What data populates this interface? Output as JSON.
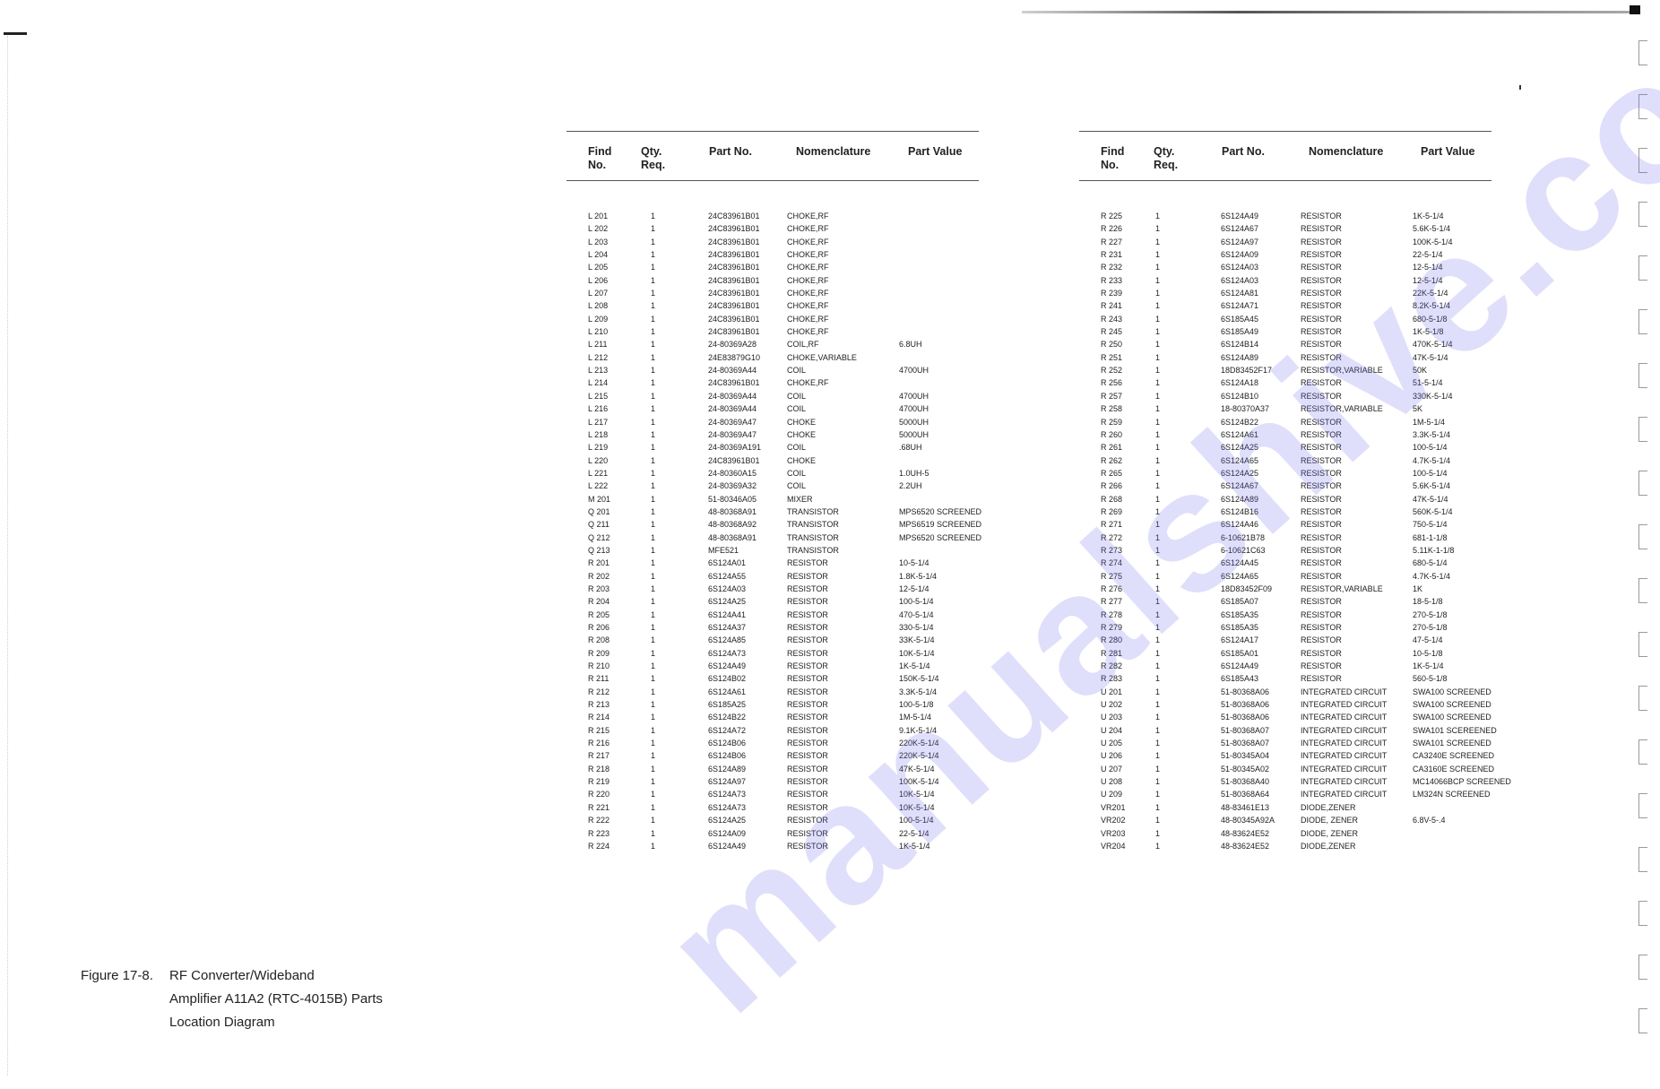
{
  "figure_caption": {
    "label": "Figure 17-8.",
    "lines": [
      "RF Converter/Wideband",
      "Amplifier A11A2 (RTC-4015B) Parts",
      "Location Diagram"
    ]
  },
  "watermark": "manualshive.com",
  "columns": {
    "find": "Find",
    "find2": "No.",
    "qty": "Qty.",
    "qty2": "Req.",
    "part_no": "Part No.",
    "nomenclature": "Nomenclature",
    "part_value": "Part Value"
  },
  "left_table": [
    {
      "find": "L 201",
      "qty": "1",
      "part_no": "24C83961B01",
      "nom": "CHOKE,RF",
      "value": ""
    },
    {
      "find": "L 202",
      "qty": "1",
      "part_no": "24C83961B01",
      "nom": "CHOKE,RF",
      "value": ""
    },
    {
      "find": "L 203",
      "qty": "1",
      "part_no": "24C83961B01",
      "nom": "CHOKE,RF",
      "value": ""
    },
    {
      "find": "L 204",
      "qty": "1",
      "part_no": "24C83961B01",
      "nom": "CHOKE,RF",
      "value": ""
    },
    {
      "find": "L 205",
      "qty": "1",
      "part_no": "24C83961B01",
      "nom": "CHOKE,RF",
      "value": ""
    },
    {
      "find": "L 206",
      "qty": "1",
      "part_no": "24C83961B01",
      "nom": "CHOKE,RF",
      "value": ""
    },
    {
      "find": "L 207",
      "qty": "1",
      "part_no": "24C83961B01",
      "nom": "CHOKE,RF",
      "value": ""
    },
    {
      "find": "L 208",
      "qty": "1",
      "part_no": "24C83961B01",
      "nom": "CHOKE,RF",
      "value": ""
    },
    {
      "find": "L 209",
      "qty": "1",
      "part_no": "24C83961B01",
      "nom": "CHOKE,RF",
      "value": ""
    },
    {
      "find": "L 210",
      "qty": "1",
      "part_no": "24C83961B01",
      "nom": "CHOKE,RF",
      "value": ""
    },
    {
      "find": "L 211",
      "qty": "1",
      "part_no": "24-80369A28",
      "nom": "COIL,RF",
      "value": "6.8UH"
    },
    {
      "find": "L 212",
      "qty": "1",
      "part_no": "24E83879G10",
      "nom": "CHOKE,VARIABLE",
      "value": ""
    },
    {
      "find": "L 213",
      "qty": "1",
      "part_no": "24-80369A44",
      "nom": "COIL",
      "value": "4700UH"
    },
    {
      "find": "L 214",
      "qty": "1",
      "part_no": "24C83961B01",
      "nom": "CHOKE,RF",
      "value": ""
    },
    {
      "find": "L 215",
      "qty": "1",
      "part_no": "24-80369A44",
      "nom": "COIL",
      "value": "4700UH"
    },
    {
      "find": "L 216",
      "qty": "1",
      "part_no": "24-80369A44",
      "nom": "COIL",
      "value": "4700UH"
    },
    {
      "find": "L 217",
      "qty": "1",
      "part_no": "24-80369A47",
      "nom": "CHOKE",
      "value": "5000UH"
    },
    {
      "find": "L 218",
      "qty": "1",
      "part_no": "24-80369A47",
      "nom": "CHOKE",
      "value": "5000UH"
    },
    {
      "find": "L 219",
      "qty": "1",
      "part_no": "24-80369A191",
      "nom": "COIL",
      "value": ".68UH"
    },
    {
      "find": "L 220",
      "qty": "1",
      "part_no": "24C83961B01",
      "nom": "CHOKE",
      "value": ""
    },
    {
      "find": "L 221",
      "qty": "1",
      "part_no": "24-80360A15",
      "nom": "COIL",
      "value": "1.0UH-5"
    },
    {
      "find": "L 222",
      "qty": "1",
      "part_no": "24-80369A32",
      "nom": "COIL",
      "value": "2.2UH"
    },
    {
      "find": "M 201",
      "qty": "1",
      "part_no": "51-80346A05",
      "nom": "MIXER",
      "value": ""
    },
    {
      "find": "Q 201",
      "qty": "1",
      "part_no": "48-80368A91",
      "nom": "TRANSISTOR",
      "value": "MPS6520 SCREENED"
    },
    {
      "find": "Q 211",
      "qty": "1",
      "part_no": "48-80368A92",
      "nom": "TRANSISTOR",
      "value": "MPS6519 SCREENED"
    },
    {
      "find": "Q 212",
      "qty": "1",
      "part_no": "48-80368A91",
      "nom": "TRANSISTOR",
      "value": "MPS6520 SCREENED"
    },
    {
      "find": "Q 213",
      "qty": "1",
      "part_no": "MFE521",
      "nom": "TRANSISTOR",
      "value": ""
    },
    {
      "find": "R 201",
      "qty": "1",
      "part_no": "6S124A01",
      "nom": "RESISTOR",
      "value": "10-5-1/4"
    },
    {
      "find": "R 202",
      "qty": "1",
      "part_no": "6S124A55",
      "nom": "RESISTOR",
      "value": "1.8K-5-1/4"
    },
    {
      "find": "R 203",
      "qty": "1",
      "part_no": "6S124A03",
      "nom": "RESISTOR",
      "value": "12-5-1/4"
    },
    {
      "find": "R 204",
      "qty": "1",
      "part_no": "6S124A25",
      "nom": "RESISTOR",
      "value": "100-5-1/4"
    },
    {
      "find": "R 205",
      "qty": "1",
      "part_no": "6S124A41",
      "nom": "RESISTOR",
      "value": "470-5-1/4"
    },
    {
      "find": "R 206",
      "qty": "1",
      "part_no": "6S124A37",
      "nom": "RESISTOR",
      "value": "330-5-1/4"
    },
    {
      "find": "R 208",
      "qty": "1",
      "part_no": "6S124A85",
      "nom": "RESISTOR",
      "value": "33K-5-1/4"
    },
    {
      "find": "R 209",
      "qty": "1",
      "part_no": "6S124A73",
      "nom": "RESISTOR",
      "value": "10K-5-1/4"
    },
    {
      "find": "R 210",
      "qty": "1",
      "part_no": "6S124A49",
      "nom": "RESISTOR",
      "value": "1K-5-1/4"
    },
    {
      "find": "R 211",
      "qty": "1",
      "part_no": "6S124B02",
      "nom": "RESISTOR",
      "value": "150K-5-1/4"
    },
    {
      "find": "R 212",
      "qty": "1",
      "part_no": "6S124A61",
      "nom": "RESISTOR",
      "value": "3.3K-5-1/4"
    },
    {
      "find": "R 213",
      "qty": "1",
      "part_no": "6S185A25",
      "nom": "RESISTOR",
      "value": "100-5-1/8"
    },
    {
      "find": "R 214",
      "qty": "1",
      "part_no": "6S124B22",
      "nom": "RESISTOR",
      "value": "1M-5-1/4"
    },
    {
      "find": "R 215",
      "qty": "1",
      "part_no": "6S124A72",
      "nom": "RESISTOR",
      "value": "9.1K-5-1/4"
    },
    {
      "find": "R 216",
      "qty": "1",
      "part_no": "6S124B06",
      "nom": "RESISTOR",
      "value": "220K-5-1/4"
    },
    {
      "find": "R 217",
      "qty": "1",
      "part_no": "6S124B06",
      "nom": "RESISTOR",
      "value": "220K-5-1/4"
    },
    {
      "find": "R 218",
      "qty": "1",
      "part_no": "6S124A89",
      "nom": "RESISTOR",
      "value": "47K-5-1/4"
    },
    {
      "find": "R 219",
      "qty": "1",
      "part_no": "6S124A97",
      "nom": "RESISTOR",
      "value": "100K-5-1/4"
    },
    {
      "find": "R 220",
      "qty": "1",
      "part_no": "6S124A73",
      "nom": "RESISTOR",
      "value": "10K-5-1/4"
    },
    {
      "find": "R 221",
      "qty": "1",
      "part_no": "6S124A73",
      "nom": "RESISTOR",
      "value": "10K-5-1/4"
    },
    {
      "find": "R 222",
      "qty": "1",
      "part_no": "6S124A25",
      "nom": "RESISTOR",
      "value": "100-5-1/4"
    },
    {
      "find": "R 223",
      "qty": "1",
      "part_no": "6S124A09",
      "nom": "RESISTOR",
      "value": "22-5-1/4"
    },
    {
      "find": "R 224",
      "qty": "1",
      "part_no": "6S124A49",
      "nom": "RESISTOR",
      "value": "1K-5-1/4"
    }
  ],
  "right_table": [
    {
      "find": "R 225",
      "qty": "1",
      "part_no": "6S124A49",
      "nom": "RESISTOR",
      "value": "1K-5-1/4"
    },
    {
      "find": "R 226",
      "qty": "1",
      "part_no": "6S124A67",
      "nom": "RESISTOR",
      "value": "5.6K-5-1/4"
    },
    {
      "find": "R 227",
      "qty": "1",
      "part_no": "6S124A97",
      "nom": "RESISTOR",
      "value": "100K-5-1/4"
    },
    {
      "find": "R 231",
      "qty": "1",
      "part_no": "6S124A09",
      "nom": "RESISTOR",
      "value": "22-5-1/4"
    },
    {
      "find": "R 232",
      "qty": "1",
      "part_no": "6S124A03",
      "nom": "RESISTOR",
      "value": "12-5-1/4"
    },
    {
      "find": "R 233",
      "qty": "1",
      "part_no": "6S124A03",
      "nom": "RESISTOR",
      "value": "12-5-1/4"
    },
    {
      "find": "R 239",
      "qty": "1",
      "part_no": "6S124A81",
      "nom": "RESISTOR",
      "value": "22K-5-1/4"
    },
    {
      "find": "R 241",
      "qty": "1",
      "part_no": "6S124A71",
      "nom": "RESISTOR",
      "value": "8.2K-5-1/4"
    },
    {
      "find": "R 243",
      "qty": "1",
      "part_no": "6S185A45",
      "nom": "RESISTOR",
      "value": "680-5-1/8"
    },
    {
      "find": "R 245",
      "qty": "1",
      "part_no": "6S185A49",
      "nom": "RESISTOR",
      "value": "1K-5-1/8"
    },
    {
      "find": "R 250",
      "qty": "1",
      "part_no": "6S124B14",
      "nom": "RESISTOR",
      "value": "470K-5-1/4"
    },
    {
      "find": "R 251",
      "qty": "1",
      "part_no": "6S124A89",
      "nom": "RESISTOR",
      "value": "47K-5-1/4"
    },
    {
      "find": "R 252",
      "qty": "1",
      "part_no": "18D83452F17",
      "nom": "RESISTOR,VARIABLE",
      "value": "50K"
    },
    {
      "find": "R 256",
      "qty": "1",
      "part_no": "6S124A18",
      "nom": "RESISTOR",
      "value": "51-5-1/4"
    },
    {
      "find": "R 257",
      "qty": "1",
      "part_no": "6S124B10",
      "nom": "RESISTOR",
      "value": "330K-5-1/4"
    },
    {
      "find": "R 258",
      "qty": "1",
      "part_no": "18-80370A37",
      "nom": "RESISTOR,VARIABLE",
      "value": "5K"
    },
    {
      "find": "R 259",
      "qty": "1",
      "part_no": "6S124B22",
      "nom": "RESISTOR",
      "value": "1M-5-1/4"
    },
    {
      "find": "R 260",
      "qty": "1",
      "part_no": "6S124A61",
      "nom": "RESISTOR",
      "value": "3.3K-5-1/4"
    },
    {
      "find": "R 261",
      "qty": "1",
      "part_no": "6S124A25",
      "nom": "RESISTOR",
      "value": "100-5-1/4"
    },
    {
      "find": "R 262",
      "qty": "1",
      "part_no": "6S124A65",
      "nom": "RESISTOR",
      "value": "4.7K-5-1/4"
    },
    {
      "find": "R 265",
      "qty": "1",
      "part_no": "6S124A25",
      "nom": "RESISTOR",
      "value": "100-5-1/4"
    },
    {
      "find": "R 266",
      "qty": "1",
      "part_no": "6S124A67",
      "nom": "RESISTOR",
      "value": "5.6K-5-1/4"
    },
    {
      "find": "R 268",
      "qty": "1",
      "part_no": "6S124A89",
      "nom": "RESISTOR",
      "value": "47K-5-1/4"
    },
    {
      "find": "R 269",
      "qty": "1",
      "part_no": "6S124B16",
      "nom": "RESISTOR",
      "value": "560K-5-1/4"
    },
    {
      "find": "R 271",
      "qty": "1",
      "part_no": "6S124A46",
      "nom": "RESISTOR",
      "value": "750-5-1/4"
    },
    {
      "find": "R 272",
      "qty": "1",
      "part_no": "6-10621B78",
      "nom": "RESISTOR",
      "value": "681-1-1/8"
    },
    {
      "find": "R 273",
      "qty": "1",
      "part_no": "6-10621C63",
      "nom": "RESISTOR",
      "value": "5.11K-1-1/8"
    },
    {
      "find": "R 274",
      "qty": "1",
      "part_no": "6S124A45",
      "nom": "RESISTOR",
      "value": "680-5-1/4"
    },
    {
      "find": "R 275",
      "qty": "1",
      "part_no": "6S124A65",
      "nom": "RESISTOR",
      "value": "4.7K-5-1/4"
    },
    {
      "find": "R 276",
      "qty": "1",
      "part_no": "18D83452F09",
      "nom": "RESISTOR,VARIABLE",
      "value": "1K"
    },
    {
      "find": "R 277",
      "qty": "1",
      "part_no": "6S185A07",
      "nom": "RESISTOR",
      "value": "18-5-1/8"
    },
    {
      "find": "R 278",
      "qty": "1",
      "part_no": "6S185A35",
      "nom": "RESISTOR",
      "value": "270-5-1/8"
    },
    {
      "find": "R 279",
      "qty": "1",
      "part_no": "6S185A35",
      "nom": "RESISTOR",
      "value": "270-5-1/8"
    },
    {
      "find": "R 280",
      "qty": "1",
      "part_no": "6S124A17",
      "nom": "RESISTOR",
      "value": "47-5-1/4"
    },
    {
      "find": "R 281",
      "qty": "1",
      "part_no": "6S185A01",
      "nom": "RESISTOR",
      "value": "10-5-1/8"
    },
    {
      "find": "R 282",
      "qty": "1",
      "part_no": "6S124A49",
      "nom": "RESISTOR",
      "value": "1K-5-1/4"
    },
    {
      "find": "R 283",
      "qty": "1",
      "part_no": "6S185A43",
      "nom": "RESISTOR",
      "value": "560-5-1/8"
    },
    {
      "find": "U 201",
      "qty": "1",
      "part_no": "51-80368A06",
      "nom": "INTEGRATED CIRCUIT",
      "value": "SWA100 SCREENED"
    },
    {
      "find": "U 202",
      "qty": "1",
      "part_no": "51-80368A06",
      "nom": "INTEGRATED CIRCUIT",
      "value": "SWA100 SCREENED"
    },
    {
      "find": "U 203",
      "qty": "1",
      "part_no": "51-80368A06",
      "nom": "INTEGRATED CIRCUIT",
      "value": "SWA100 SCREENED"
    },
    {
      "find": "U 204",
      "qty": "1",
      "part_no": "51-80368A07",
      "nom": "INTEGRATED CIRCUIT",
      "value": "SWA101 SCEREENED"
    },
    {
      "find": "U 205",
      "qty": "1",
      "part_no": "51-80368A07",
      "nom": "INTEGRATED CIRCUIT",
      "value": "SWA101 SCREENED"
    },
    {
      "find": "U 206",
      "qty": "1",
      "part_no": "51-80345A04",
      "nom": "INTEGRATED CIRCUIT",
      "value": "CA3240E SCREENED"
    },
    {
      "find": "U 207",
      "qty": "1",
      "part_no": "51-80345A02",
      "nom": "INTEGRATED CIRCUIT",
      "value": "CA3160E SCREENED"
    },
    {
      "find": "U 208",
      "qty": "1",
      "part_no": "51-80368A40",
      "nom": "INTEGRATED CIRCUIT",
      "value": "MC14066BCP SCREENED"
    },
    {
      "find": "U 209",
      "qty": "1",
      "part_no": "51-80368A64",
      "nom": "INTEGRATED CIRCUIT",
      "value": "LM324N SCREENED"
    },
    {
      "find": "VR201",
      "qty": "1",
      "part_no": "48-83461E13",
      "nom": "DIODE,ZENER",
      "value": ""
    },
    {
      "find": "VR202",
      "qty": "1",
      "part_no": "48-80345A92A",
      "nom": "DIODE, ZENER",
      "value": "6.8V-5-.4"
    },
    {
      "find": "VR203",
      "qty": "1",
      "part_no": "48-83624E52",
      "nom": "DIODE, ZENER",
      "value": ""
    },
    {
      "find": "VR204",
      "qty": "1",
      "part_no": "48-83624E52",
      "nom": "DIODE,ZENER",
      "value": ""
    }
  ]
}
